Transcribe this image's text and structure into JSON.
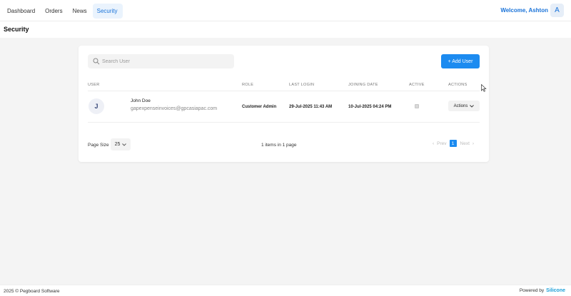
{
  "nav": {
    "items": [
      {
        "label": "Dashboard"
      },
      {
        "label": "Orders"
      },
      {
        "label": "News"
      },
      {
        "label": "Security"
      }
    ],
    "welcome": "Welcome, Ashton",
    "avatar_letter": "A"
  },
  "page": {
    "title": "Security"
  },
  "search": {
    "placeholder": "Search User"
  },
  "add_user_label": "+ Add User",
  "table": {
    "headers": [
      "USER",
      "ROLE",
      "LAST LOGIN",
      "JOINING DATE",
      "ACTIVE",
      "ACTIONS"
    ],
    "rows": [
      {
        "avatar_letter": "J",
        "name": "John Doe",
        "email": "gapexpenseinvoices@gpcasiapac.com",
        "role": "Customer Admin",
        "last_login": "29-Jul-2025 11:43 AM",
        "joining_date": "10-Jul-2025 04:24 PM",
        "active": true,
        "actions_label": "Actions"
      }
    ]
  },
  "pagination": {
    "page_size_label": "Page Size",
    "page_size": "25",
    "items_info": "1 items in 1 page",
    "prev_label": "Prev",
    "current_page": "1",
    "next_label": "Next"
  },
  "footer": {
    "copyright": "2025 © Pegboard Software",
    "powered_by": "Powered by",
    "brand": "Silicone"
  },
  "colors": {
    "accent": "#1c8bf0",
    "brand": "#1ea0d8"
  }
}
